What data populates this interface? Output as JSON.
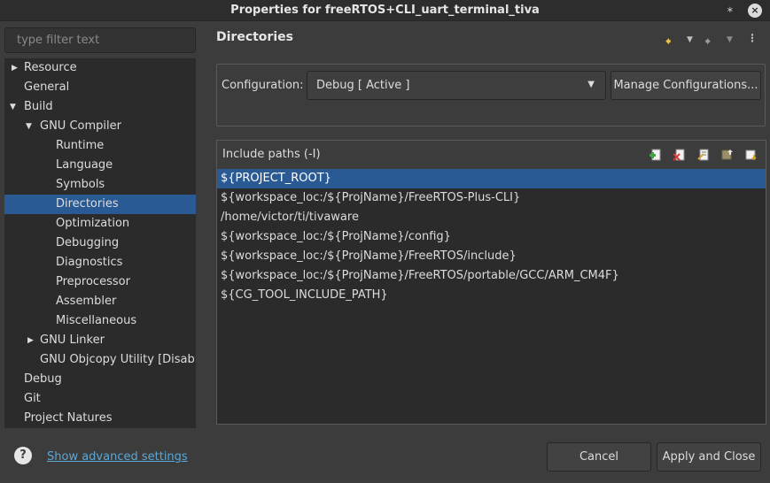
{
  "window": {
    "title": "Properties for freeRTOS+CLI_uart_terminal_tiva"
  },
  "filter": {
    "placeholder": "type filter text"
  },
  "tree": {
    "items": [
      {
        "label": "Resource",
        "expander": "collapsed"
      },
      {
        "label": "General",
        "expander": "none"
      },
      {
        "label": "Build",
        "expander": "expanded"
      },
      {
        "label": "GNU Compiler",
        "expander": "expanded"
      },
      {
        "label": "Runtime",
        "expander": "none"
      },
      {
        "label": "Language",
        "expander": "none"
      },
      {
        "label": "Symbols",
        "expander": "none"
      },
      {
        "label": "Directories",
        "expander": "none",
        "selected": true
      },
      {
        "label": "Optimization",
        "expander": "none"
      },
      {
        "label": "Debugging",
        "expander": "none"
      },
      {
        "label": "Diagnostics",
        "expander": "none"
      },
      {
        "label": "Preprocessor",
        "expander": "none"
      },
      {
        "label": "Assembler",
        "expander": "none"
      },
      {
        "label": "Miscellaneous",
        "expander": "none"
      },
      {
        "label": "GNU Linker",
        "expander": "collapsed"
      },
      {
        "label": "GNU Objcopy Utility  [Disabled]",
        "expander": "none"
      },
      {
        "label": "Debug",
        "expander": "none"
      },
      {
        "label": "Git",
        "expander": "none"
      },
      {
        "label": "Project Natures",
        "expander": "none"
      }
    ]
  },
  "page": {
    "title": "Directories"
  },
  "configuration": {
    "label": "Configuration:",
    "value": "Debug  [ Active ]",
    "manage_label": "Manage Configurations..."
  },
  "include_paths": {
    "title": "Include paths (-I)",
    "items": [
      "${PROJECT_ROOT}",
      "${workspace_loc:/${ProjName}/FreeRTOS-Plus-CLI}",
      "/home/victor/ti/tivaware",
      "${workspace_loc:/${ProjName}/config}",
      "${workspace_loc:/${ProjName}/FreeRTOS/include}",
      "${workspace_loc:/${ProjName}/FreeRTOS/portable/GCC/ARM_CM4F}",
      "${CG_TOOL_INCLUDE_PATH}"
    ],
    "selected_index": 0
  },
  "footer": {
    "advanced_link": "Show advanced settings",
    "cancel_label": "Cancel",
    "apply_label": "Apply and Close"
  },
  "colors": {
    "selection": "#2a5a94",
    "link": "#5ba7d6",
    "background": "#3c3c3c"
  }
}
